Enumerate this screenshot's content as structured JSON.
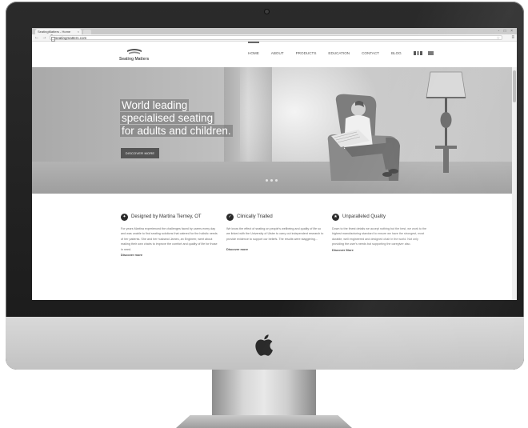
{
  "browser": {
    "tab_title": "SeatingMatters - Home",
    "tab_close": "×",
    "window_controls": "- □ ×",
    "nav_buttons": "← → C",
    "url": "seatingmatters.com",
    "star": "☆",
    "menu": "≡"
  },
  "site": {
    "logo_text": "Seating Matters",
    "nav": [
      {
        "label": "HOME"
      },
      {
        "label": "ABOUT"
      },
      {
        "label": "PRODUCTS"
      },
      {
        "label": "EDUCATION"
      },
      {
        "label": "CONTACT"
      },
      {
        "label": "BLOG"
      }
    ],
    "hero": {
      "headline_lines": [
        "World leading",
        "specialised seating",
        "for adults and children."
      ],
      "button_label": "DISCOVER MORE"
    },
    "features": [
      {
        "icon": "lightbulb-icon",
        "icon_glyph": "✦",
        "title": "Designed by Martina Tierney, OT",
        "body": "For years Martina experienced the challenges faced by carers every day and was unable to find seating solutions that catered for the holistic needs of her patients. She and her husband James, an Engineer, went about making their own chairs to improve the comfort and quality of life for those in need.",
        "link": "Discover more"
      },
      {
        "icon": "check-icon",
        "icon_glyph": "✓",
        "title": "Clinically Trialled",
        "body": "We know the effect of seating on people's wellbeing and quality of life so we linked with the University of Ulster to carry out independent research to provide evidence to support our beliefs. The results were staggering...",
        "link": "Discover more"
      },
      {
        "icon": "star-icon",
        "icon_glyph": "★",
        "title": "Unparalleled Quality",
        "body": "Down to the finest details we accept nothing but the best, we work to the highest manufacturing standard to ensure we have the strongest, most durable, well engineered and designed chair in the world. Not only providing the user's needs but supporting the caregiver also.",
        "link": "Discover More"
      }
    ]
  }
}
